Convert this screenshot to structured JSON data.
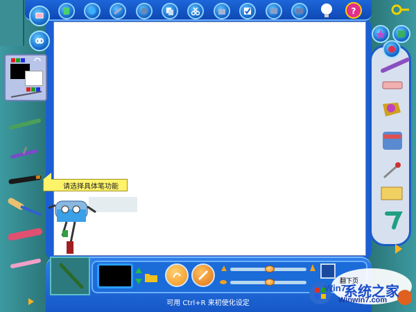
{
  "tooltip": {
    "text": "请选择具体笔功能"
  },
  "status": {
    "hint": "可用 Ctrl+R 来初使化设定"
  },
  "watermark": {
    "label": "翻下页",
    "brand": "系统之家",
    "win_text": "Win7",
    "url": "Winwin7.com"
  },
  "colors": {
    "frame_blue": "#1a5fd3",
    "teal": "#2f7f83",
    "tooltip_yellow": "#fff36a",
    "help": "#e0308c"
  },
  "top_icons": [
    "new-icon",
    "open-icon",
    "save-icon",
    "print-icon",
    "copy-icon",
    "cut-icon",
    "paste-icon",
    "check-icon",
    "image-icon",
    "picture-icon",
    "bulb-icon",
    "help-icon"
  ],
  "left_tools": [
    "crayon-icon",
    "airbrush-icon",
    "marker-icon",
    "paintbrush-icon",
    "lipstick-icon",
    "chalk-icon"
  ],
  "right_tools": [
    "brush-icon",
    "eraser-icon",
    "paint-bucket-icon",
    "paint-can-icon",
    "dropper-icon",
    "stamp-pad-icon",
    "spray-nozzle-icon"
  ]
}
